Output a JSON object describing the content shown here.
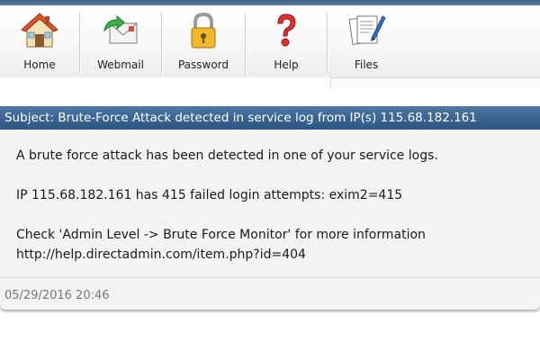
{
  "toolbar": {
    "items": [
      {
        "label": "Home",
        "icon": "home-icon"
      },
      {
        "label": "Webmail",
        "icon": "envelope-icon"
      },
      {
        "label": "Password",
        "icon": "padlock-icon"
      },
      {
        "label": "Help",
        "icon": "question-mark-icon"
      },
      {
        "label": "Files",
        "icon": "files-icon"
      }
    ]
  },
  "message": {
    "subject": "Subject: Brute-Force Attack detected in service log from IP(s) 115.68.182.161",
    "lines": [
      "A brute force attack has been detected in one of your service logs.",
      "IP 115.68.182.161 has 415 failed login attempts: exim2=415",
      "Check 'Admin Level -> Brute Force Monitor' for more information",
      "http://help.directadmin.com/item.php?id=404"
    ],
    "date": "05/29/2016 20:46"
  },
  "colors": {
    "subject_bar": "#3a6391",
    "top_strip": "#4a6c94",
    "panel_bg": "#f3f3f3",
    "date_text": "#777777"
  }
}
